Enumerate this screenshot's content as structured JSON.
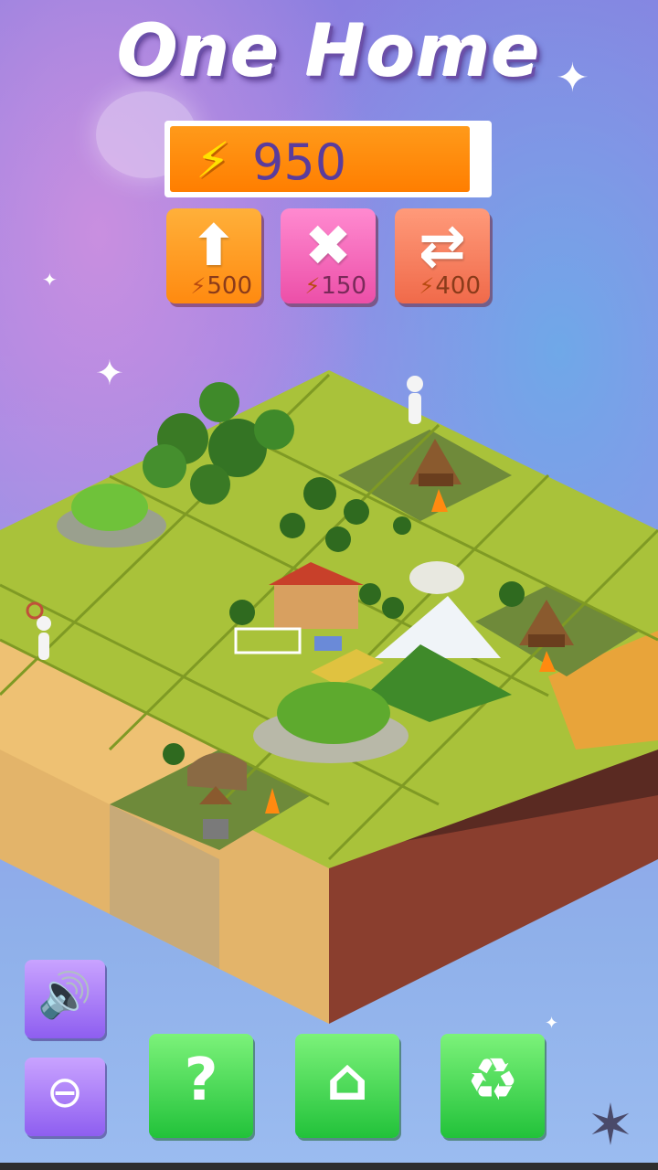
{
  "title": "One Home",
  "energy": {
    "value": "950",
    "icon": "lightning-icon",
    "bar_color": "#ff8000"
  },
  "tools": [
    {
      "name": "upgrade",
      "icon": "arrow-up-icon",
      "cost": "500"
    },
    {
      "name": "remove",
      "icon": "cross-icon",
      "cost": "150"
    },
    {
      "name": "swap",
      "icon": "swap-tiles-icon",
      "cost": "400"
    }
  ],
  "side_buttons": [
    {
      "name": "sound",
      "icon": "speaker-icon"
    },
    {
      "name": "zoom-out",
      "icon": "minus-icon"
    }
  ],
  "bottom_buttons": [
    {
      "name": "help",
      "icon": "question-icon"
    },
    {
      "name": "tile-cards",
      "icon": "home-cards-icon"
    },
    {
      "name": "recycle",
      "icon": "recycle-icon"
    }
  ],
  "corner_icon": "star-badge-icon"
}
